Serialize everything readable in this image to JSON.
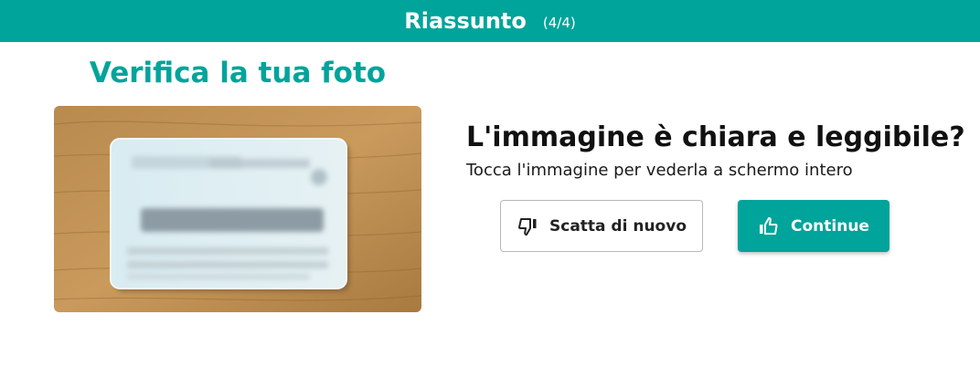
{
  "header": {
    "title": "Riassunto",
    "step": "(4/4)"
  },
  "photo_section": {
    "heading": "Verifica la tua foto"
  },
  "review": {
    "question": "L'immagine è chiara e leggibile?",
    "hint": "Tocca l'immagine per vederla a schermo intero"
  },
  "actions": {
    "retake_label": "Scatta di nuovo",
    "continue_label": "Continue"
  },
  "icons": {
    "retake": "thumbs-down-icon",
    "continue": "thumbs-up-icon"
  },
  "colors": {
    "accent": "#00a49a",
    "text": "#111111",
    "button_border": "#b8b8b8"
  }
}
